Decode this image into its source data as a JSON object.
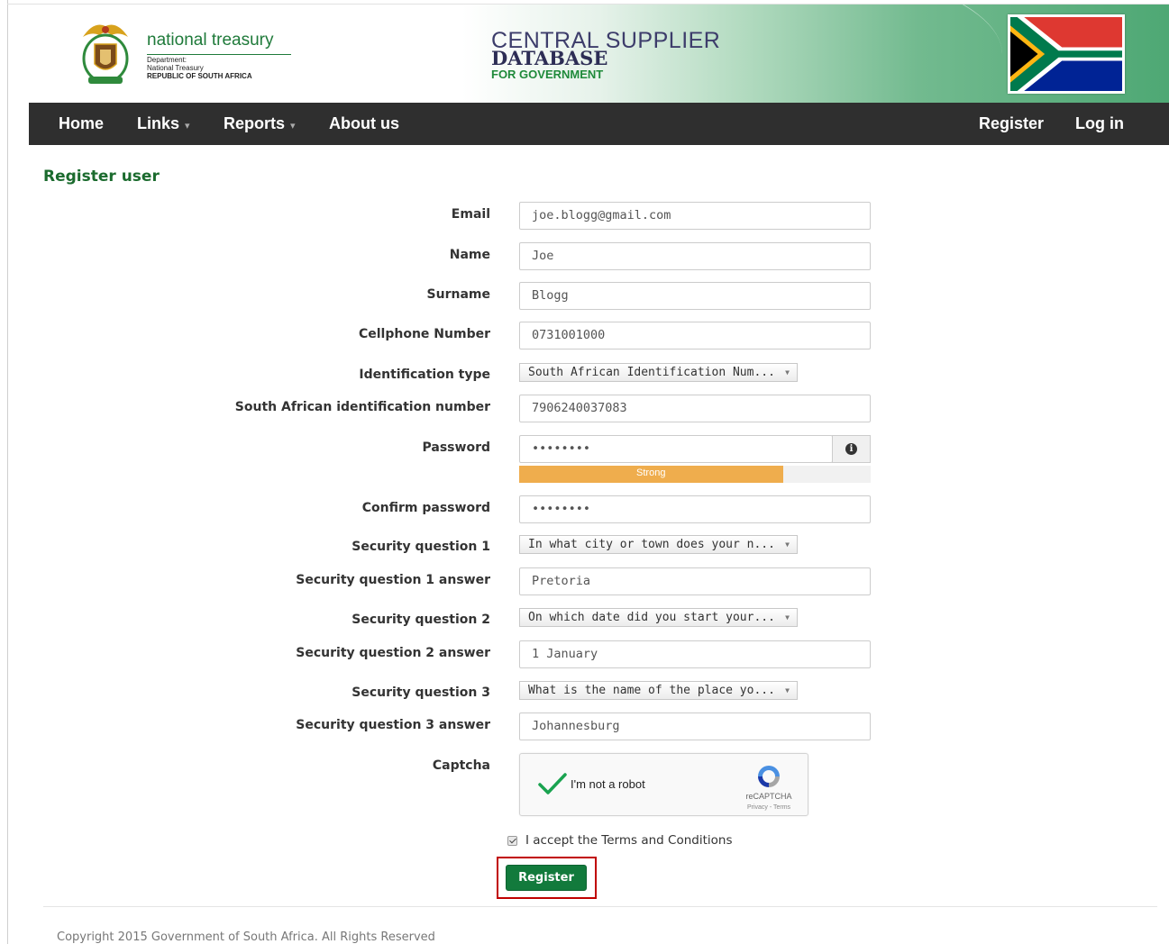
{
  "header": {
    "brand_name": "national treasury",
    "brand_sub_1": "Department:",
    "brand_sub_2": "National Treasury",
    "brand_sub_3": "REPUBLIC OF SOUTH AFRICA",
    "title_line_1": "CENTRAL SUPPLIER",
    "title_line_2": "DATABASE",
    "title_line_3": "FOR GOVERNMENT"
  },
  "nav": {
    "home": "Home",
    "links": "Links",
    "reports": "Reports",
    "about": "About us",
    "register": "Register",
    "login": "Log in"
  },
  "page_title": "Register user",
  "form": {
    "email": {
      "label": "Email",
      "value": "joe.blogg@gmail.com"
    },
    "name": {
      "label": "Name",
      "value": "Joe"
    },
    "surname": {
      "label": "Surname",
      "value": "Blogg"
    },
    "cellphone": {
      "label": "Cellphone Number",
      "value": "0731001000"
    },
    "id_type": {
      "label": "Identification type",
      "value": "South African Identification Num..."
    },
    "id_number": {
      "label": "South African identification number",
      "value": "7906240037083"
    },
    "password": {
      "label": "Password",
      "value": "••••••••",
      "strength_label": "Strong",
      "strength_fraction": 0.75
    },
    "confirm_password": {
      "label": "Confirm password",
      "value": "••••••••"
    },
    "sq1": {
      "label": "Security question 1",
      "value": "In what city or town does your n..."
    },
    "sq1_answer": {
      "label": "Security question 1 answer",
      "value": "Pretoria"
    },
    "sq2": {
      "label": "Security question 2",
      "value": "On which date did you start your..."
    },
    "sq2_answer": {
      "label": "Security question 2 answer",
      "value": "1 January"
    },
    "sq3": {
      "label": "Security question 3",
      "value": "What is the name of the place yo..."
    },
    "sq3_answer": {
      "label": "Security question 3 answer",
      "value": "Johannesburg"
    },
    "captcha": {
      "label": "Captcha",
      "text": "I'm not a robot",
      "brand": "reCAPTCHA",
      "links": "Privacy - Terms"
    },
    "terms": "I accept the Terms and Conditions",
    "submit": "Register"
  },
  "footer": {
    "copyright": "Copyright 2015 Government of South Africa. All Rights Reserved"
  },
  "colors": {
    "brand_green": "#1b6b2e",
    "nav_bg": "#2f2f2f",
    "button_green": "#127a3c",
    "strength_orange": "#efad4d",
    "highlight_red": "#c00000"
  }
}
